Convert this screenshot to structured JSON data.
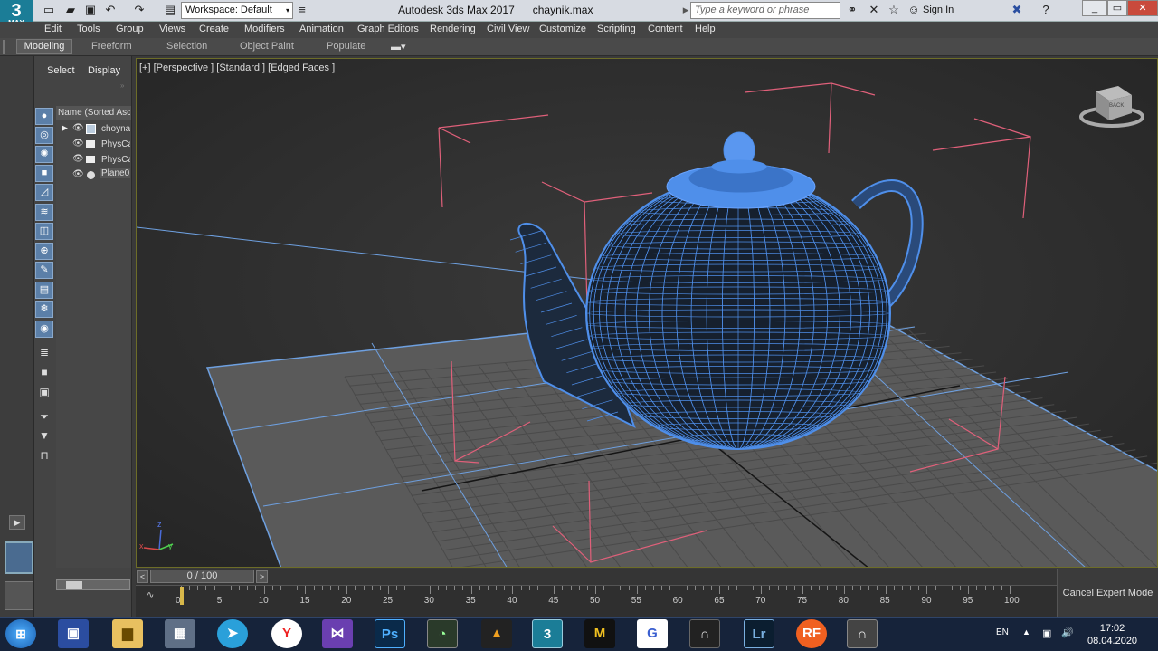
{
  "app": {
    "logo_number": "3",
    "logo_text": "MAX",
    "workspace_label": "Workspace: Default",
    "app_title": "Autodesk 3ds Max 2017",
    "file_name": "chaynik.max",
    "search_placeholder": "Type a keyword or phrase",
    "sign_in": "Sign In"
  },
  "menus": [
    "Edit",
    "Tools",
    "Group",
    "Views",
    "Create",
    "Modifiers",
    "Animation",
    "Graph Editors",
    "Rendering",
    "Civil View",
    "Customize",
    "Scripting",
    "Content",
    "Help"
  ],
  "ribbon_tabs": [
    "Modeling",
    "Freeform",
    "Selection",
    "Object Paint",
    "Populate"
  ],
  "explorer": {
    "tabs": [
      "Select",
      "Display"
    ],
    "column_header": "Name (Sorted Asc",
    "rows": [
      "choyna",
      "PhysCa",
      "PhysCa",
      "Plane0"
    ]
  },
  "viewport": {
    "label": "[+] [Perspective ] [Standard ] [Edged Faces ]",
    "axis_z": "z",
    "axis_y": "y",
    "axis_x": "x",
    "viewcube_label": "BACK"
  },
  "timeline": {
    "frame_display": "0 / 100",
    "ticks": [
      "0",
      "5",
      "10",
      "15",
      "20",
      "25",
      "30",
      "35",
      "40",
      "45",
      "50",
      "55",
      "60",
      "65",
      "70",
      "75",
      "80",
      "85",
      "90",
      "95",
      "100"
    ],
    "cancel_expert_mode": "Cancel Expert Mode"
  },
  "taskbar": {
    "language": "EN",
    "time": "17:02",
    "date": "08.04.2020",
    "apps": [
      "windows-start",
      "save",
      "explorer",
      "calculator",
      "telegram",
      "yandex",
      "visual-studio",
      "photoshop",
      "3dsmax-ext",
      "autocad",
      "3ds-max",
      "marvelous",
      "godot-like",
      "archicad",
      "lightroom",
      "realflow",
      "archicad2"
    ]
  },
  "colors": {
    "teapot": "#4f8fea",
    "grid": "#6e6e6e",
    "camera_lines": "#e0607a",
    "accent": "#1b7d97"
  }
}
